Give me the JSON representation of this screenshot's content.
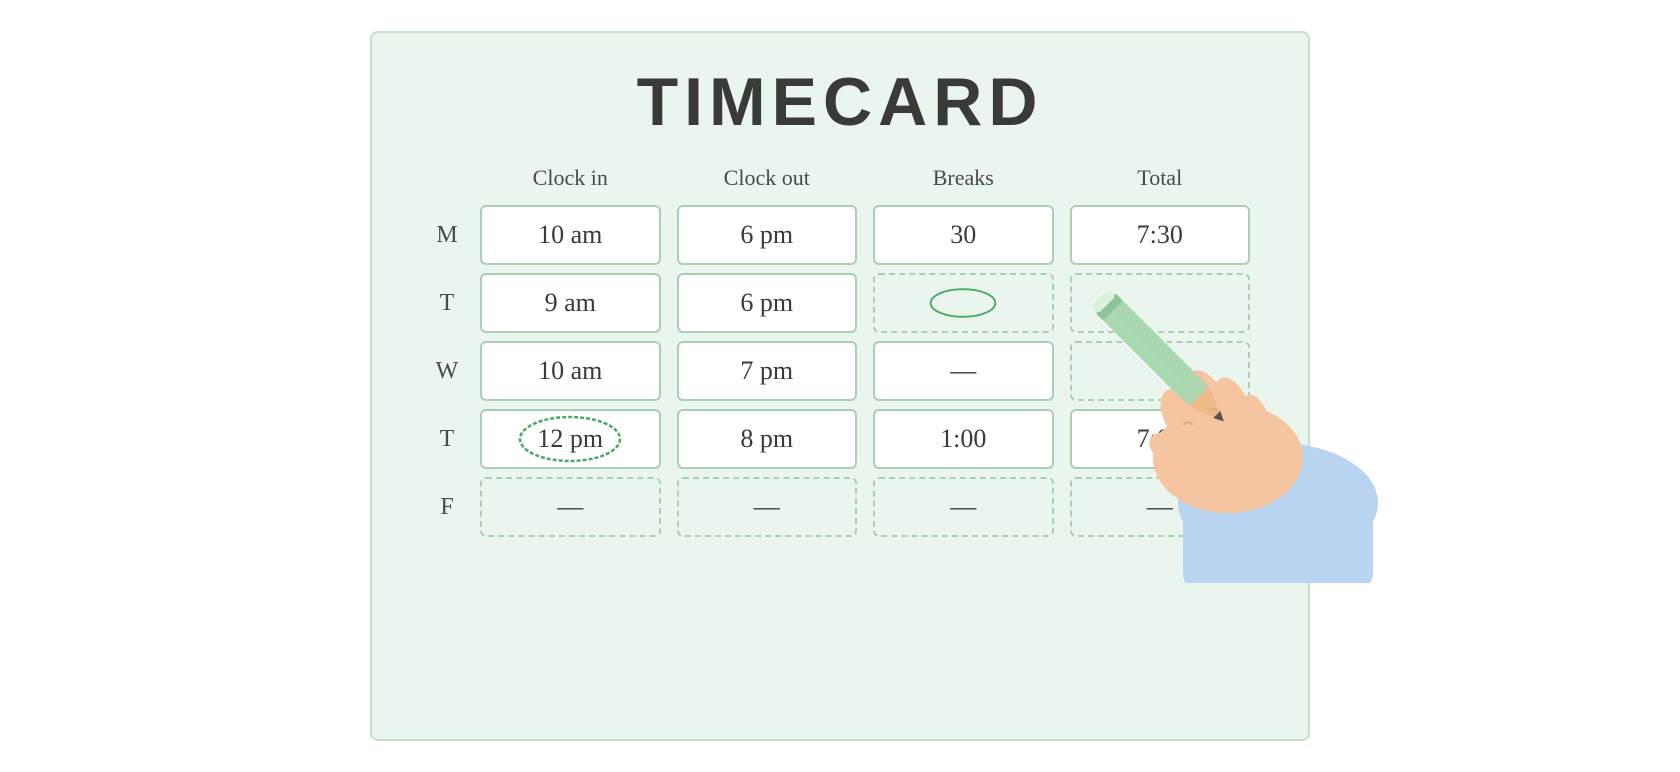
{
  "title": "TIMECARD",
  "columns": {
    "day": "",
    "clock_in": "Clock in",
    "clock_out": "Clock out",
    "breaks": "Breaks",
    "total": "Total"
  },
  "rows": [
    {
      "day": "M",
      "clock_in": "10 am",
      "clock_out": "6 pm",
      "breaks": "30",
      "total": "7:30",
      "clock_in_dashed": false,
      "clock_in_circled": false,
      "breaks_dashed": false,
      "total_dashed": false
    },
    {
      "day": "T",
      "clock_in": "9 am",
      "clock_out": "6 pm",
      "breaks": "",
      "total": "",
      "clock_in_dashed": false,
      "clock_in_circled": false,
      "breaks_dashed": true,
      "total_dashed": true
    },
    {
      "day": "W",
      "clock_in": "10 am",
      "clock_out": "7 pm",
      "breaks": "—",
      "total": "",
      "clock_in_dashed": false,
      "clock_in_circled": false,
      "breaks_dashed": false,
      "total_dashed": true
    },
    {
      "day": "T",
      "clock_in": "12 pm",
      "clock_out": "8 pm",
      "breaks": "1:00",
      "total": "7:00",
      "clock_in_dashed": false,
      "clock_in_circled": true,
      "breaks_dashed": false,
      "total_dashed": false
    },
    {
      "day": "F",
      "clock_in": "—",
      "clock_out": "—",
      "breaks": "—",
      "total": "—",
      "clock_in_dashed": true,
      "clock_in_circled": false,
      "breaks_dashed": true,
      "total_dashed": true
    }
  ],
  "accent_color": "#5daa75"
}
